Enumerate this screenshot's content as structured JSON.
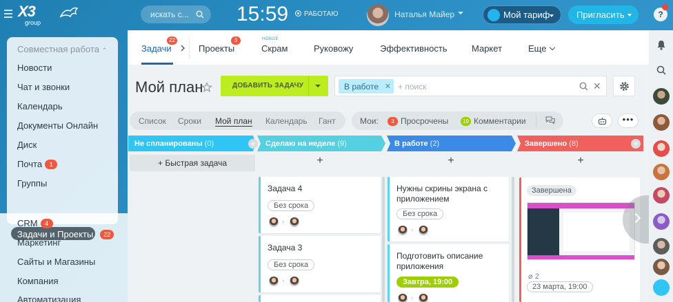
{
  "header": {
    "logo": "X3",
    "logo_sub": "group",
    "search_placeholder": "искать с...",
    "clock": "15:59",
    "work_status": "РАБОТАЮ",
    "user_name": "Наталья Майер",
    "tariff_label": "Мой тариф",
    "invite_label": "Пригласить",
    "help": "?"
  },
  "sidebar": {
    "group_label": "Совместная работа",
    "items": [
      {
        "label": "Новости"
      },
      {
        "label": "Чат и звонки"
      },
      {
        "label": "Календарь"
      },
      {
        "label": "Документы Онлайн"
      },
      {
        "label": "Диск"
      },
      {
        "label": "Почта",
        "badge": "1"
      },
      {
        "label": "Группы"
      },
      {
        "label": "Задачи и Проекты",
        "badge": "22"
      },
      {
        "label": "CRM",
        "badge": "4"
      },
      {
        "label": "Маркетинг"
      },
      {
        "label": "Сайты и Магазины"
      },
      {
        "label": "Компания"
      },
      {
        "label": "Автоматизация"
      }
    ]
  },
  "tabs": [
    {
      "label": "Задачи",
      "badge": "22"
    },
    {
      "label": "Проекты",
      "badge": "3"
    },
    {
      "label": "Скрам",
      "tag": "НОВОЕ"
    },
    {
      "label": "Руковожу"
    },
    {
      "label": "Эффективность"
    },
    {
      "label": "Маркет"
    },
    {
      "label": "Еще"
    }
  ],
  "toolbar": {
    "title": "Мой план",
    "add_task": "ДОБАВИТЬ ЗАДАЧУ",
    "filter_chip": "В работе",
    "filter_placeholder": "+ поиск"
  },
  "views": [
    "Список",
    "Сроки",
    "Мой план",
    "Календарь",
    "Гант"
  ],
  "counters": {
    "label": "Мои:",
    "overdue": {
      "num": "3",
      "label": "Просрочены",
      "color": "#f0583e"
    },
    "comments": {
      "num": "19",
      "label": "Комментарии",
      "color": "#9dcf00"
    }
  },
  "columns": [
    {
      "title": "Не спланированы",
      "count": "(0)",
      "color": "#2fc6f6"
    },
    {
      "title": "Сделаю на неделе",
      "count": "(9)",
      "color": "#55d0e0"
    },
    {
      "title": "В работе",
      "count": "(2)",
      "color": "#3b8ae6"
    },
    {
      "title": "Завершено",
      "count": "(8)",
      "color": "#f0605c"
    }
  ],
  "quick_task": "+ Быстрая задача",
  "cards": {
    "week": [
      {
        "title": "Задача 4",
        "deadline": "Без срока"
      },
      {
        "title": "Задача 3",
        "deadline": "Без срока"
      }
    ],
    "in_progress": [
      {
        "title": "Нужны скрины экрана с приложением",
        "deadline": "Без срока"
      },
      {
        "title": "Подготовить описание приложения",
        "deadline": "Завтра, 19:00"
      }
    ],
    "done": {
      "status": "Завершена",
      "files": "2",
      "date": "23 марта, 19:00"
    }
  }
}
